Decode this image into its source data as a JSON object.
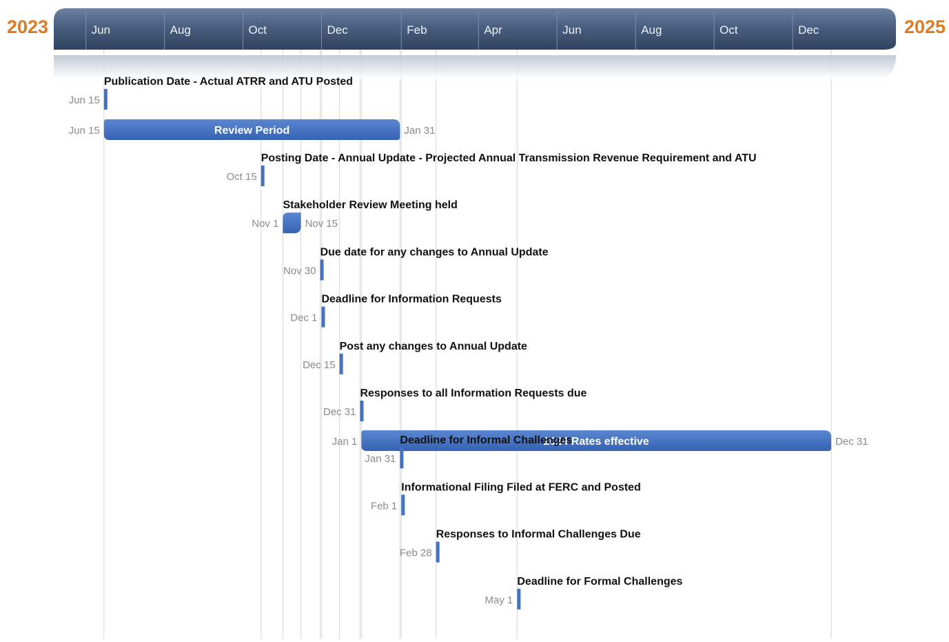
{
  "timeline": {
    "start_year": "2023",
    "end_year": "2025",
    "colors": {
      "year_label": "#e07a1f",
      "band_dark": "#3d5272",
      "band_light": "#6d82a3",
      "bar": "#4472c4",
      "bar_dark": "#2f5597",
      "milestone_text": "#111111",
      "date_text": "#8a8a8a",
      "gridline": "#d6d6d6",
      "month_tick_text": "#eef2f8"
    },
    "month_ticks": [
      "Jun",
      "Aug",
      "Oct",
      "Dec",
      "Feb",
      "Apr",
      "Jun",
      "Aug",
      "Oct",
      "Dec"
    ]
  },
  "chart_data": {
    "type": "gantt-timeline",
    "title": "",
    "x_range": [
      "2023-05-22",
      "2025-01-31"
    ],
    "axis_ticks": [
      {
        "date": "2023-06-01",
        "label": "Jun"
      },
      {
        "date": "2023-08-01",
        "label": "Aug"
      },
      {
        "date": "2023-10-01",
        "label": "Oct"
      },
      {
        "date": "2023-12-01",
        "label": "Dec"
      },
      {
        "date": "2024-02-01",
        "label": "Feb"
      },
      {
        "date": "2024-04-01",
        "label": "Apr"
      },
      {
        "date": "2024-06-01",
        "label": "Jun"
      },
      {
        "date": "2024-08-01",
        "label": "Aug"
      },
      {
        "date": "2024-10-01",
        "label": "Oct"
      },
      {
        "date": "2024-12-01",
        "label": "Dec"
      }
    ],
    "items": [
      {
        "kind": "milestone",
        "label": "Publication Date - Actual ATRR and ATU Posted",
        "date": "2023-06-15",
        "date_label": "Jun 15"
      },
      {
        "kind": "task",
        "label": "Review Period",
        "start": "2023-06-15",
        "end": "2024-01-31",
        "start_label": "Jun 15",
        "end_label": "Jan 31"
      },
      {
        "kind": "milestone",
        "label": "Posting Date - Annual Update - Projected Annual Transmission Revenue Requirement and ATU",
        "date": "2023-10-15",
        "date_label": "Oct 15"
      },
      {
        "kind": "task-small",
        "label": "Stakeholder Review Meeting held",
        "start": "2023-11-01",
        "end": "2023-11-15",
        "start_label": "Nov 1",
        "end_label": "Nov 15"
      },
      {
        "kind": "milestone",
        "label": "Due date for any changes to Annual Update",
        "date": "2023-11-30",
        "date_label": "Nov 30"
      },
      {
        "kind": "milestone",
        "label": "Deadline for Information Requests",
        "date": "2023-12-01",
        "date_label": "Dec 1"
      },
      {
        "kind": "milestone",
        "label": "Post any changes to Annual Update",
        "date": "2023-12-15",
        "date_label": "Dec 15"
      },
      {
        "kind": "milestone",
        "label": "Responses to all Information Requests due",
        "date": "2023-12-31",
        "date_label": "Dec 31"
      },
      {
        "kind": "task",
        "label": "2024 Rates effective",
        "start": "2024-01-01",
        "end": "2024-12-31",
        "start_label": "Jan 1",
        "end_label": "Dec 31"
      },
      {
        "kind": "milestone",
        "label": "Deadline for Informal Challenges",
        "date": "2024-01-31",
        "date_label": "Jan 31"
      },
      {
        "kind": "milestone",
        "label": "Informational Filing Filed at FERC and Posted",
        "date": "2024-02-01",
        "date_label": "Feb 1"
      },
      {
        "kind": "milestone",
        "label": "Responses to Informal Challenges Due",
        "date": "2024-02-28",
        "date_label": "Feb 28"
      },
      {
        "kind": "milestone",
        "label": "Deadline for Formal Challenges",
        "date": "2024-05-01",
        "date_label": "May 1"
      }
    ]
  }
}
